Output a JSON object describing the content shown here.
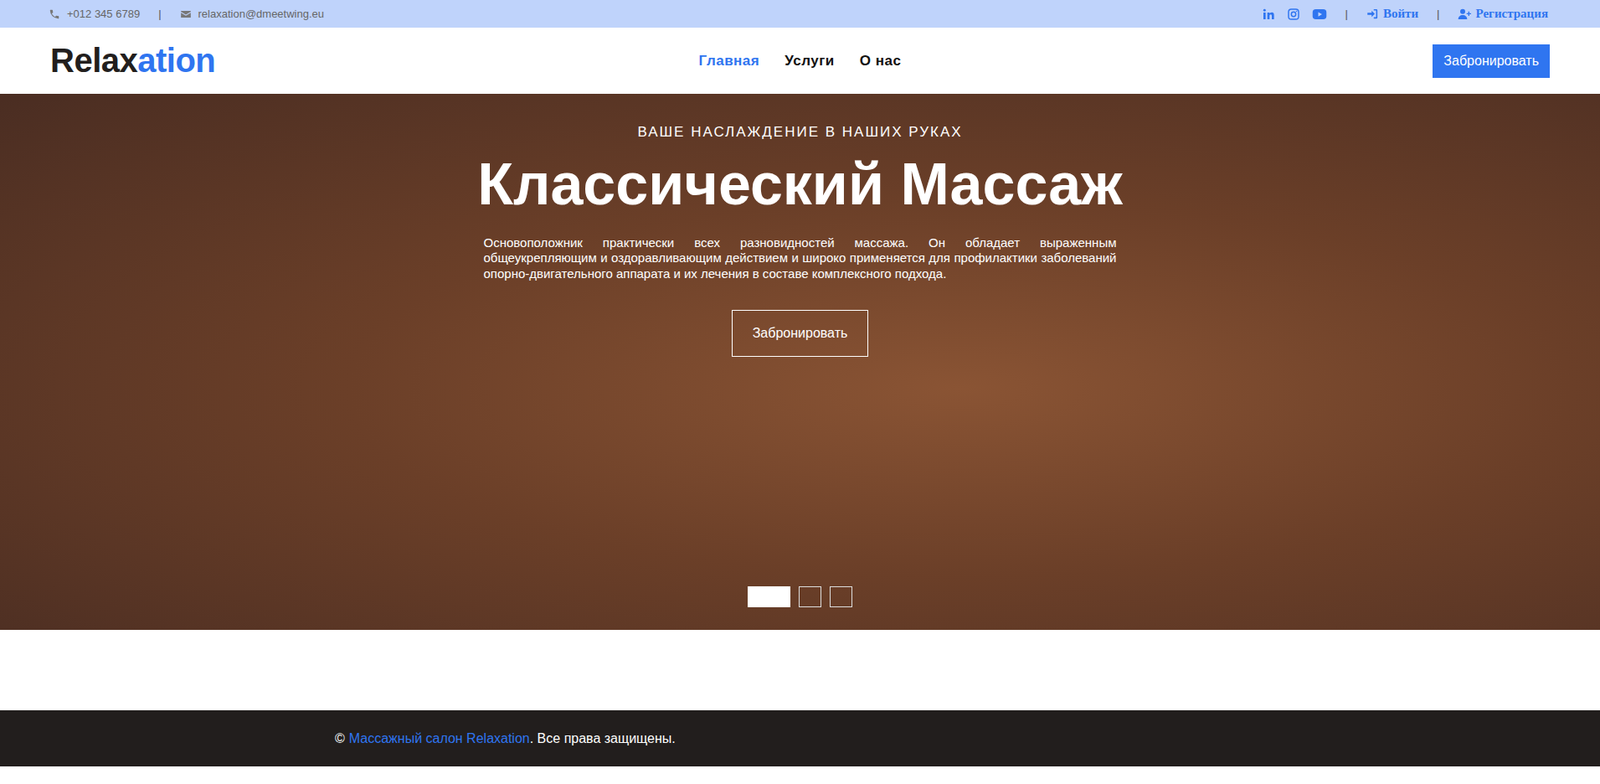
{
  "topbar": {
    "phone": "+012 345 6789",
    "email": "relaxation@dmeetwing.eu",
    "separators": [
      "|",
      "|",
      "|"
    ],
    "login": "Войти",
    "register": "Регистрация"
  },
  "logo": {
    "part1": "Relax",
    "part2": "ation"
  },
  "nav": [
    {
      "label": "Главная",
      "selected": true
    },
    {
      "label": "Услуги",
      "selected": false
    },
    {
      "label": "О нас",
      "selected": false
    }
  ],
  "book_button": "Забронировать",
  "hero": {
    "subtitle": "ВАШЕ НАСЛАЖДЕНИЕ В НАШИХ РУКАХ",
    "title": "Классический Массаж",
    "text": "Основоположник практически всех разновидностей массажа. Он обладает выраженным общеукрепляющим и оздоравливающим действием и широко применяется для профилактики заболеваний опорно-двигательного аппарата и их лечения в составе комплексного подхода.",
    "button": "Забронировать",
    "slides": [
      {
        "selected": true
      },
      {
        "selected": false
      },
      {
        "selected": false
      }
    ]
  },
  "footer": {
    "copyright": "©",
    "link": "Массажный салон Relaxation",
    "rest": ". Все права защищены."
  }
}
